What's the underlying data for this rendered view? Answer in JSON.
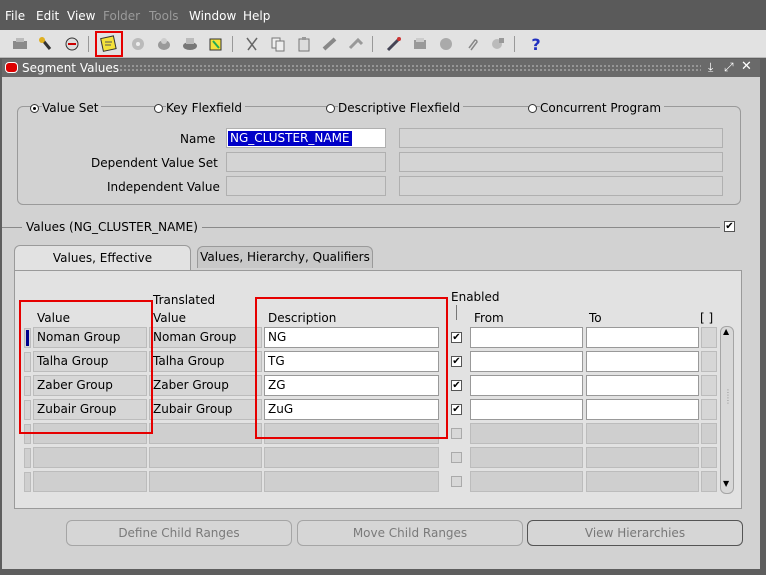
{
  "menu": [
    "File",
    "Edit",
    "View",
    "Folder",
    "Tools",
    "Window",
    "Help"
  ],
  "toolbar": {
    "icons": [
      "save-icon",
      "navigator-icon",
      "print-icon",
      "find-icon",
      "new-record-icon",
      "translation-icon",
      "zoom-icon",
      "export-icon",
      "cut-icon",
      "copy-icon",
      "paste-icon",
      "clear-icon",
      "delete-icon",
      "edit-icon",
      "attachments-icon",
      "folder-tools-icon",
      "help-icon"
    ],
    "help_glyph": "?"
  },
  "window": {
    "title": "Segment Values"
  },
  "options": [
    "Value Set",
    "Key Flexfield",
    "Descriptive Flexfield",
    "Concurrent Program"
  ],
  "selected_option": "Value Set",
  "form": {
    "name_label": "Name",
    "name_value": "NG_CLUSTER_NAME",
    "dependent_label": "Dependent Value Set",
    "independent_label": "Independent Value"
  },
  "values_section": {
    "title": "Values (NG_CLUSTER_NAME)"
  },
  "tabs": [
    "Values, Effective",
    "Values, Hierarchy, Qualifiers"
  ],
  "columns": {
    "value": "Value",
    "translated_line1": "Translated",
    "translated_line2": "Value",
    "description": "Description",
    "enabled": "Enabled",
    "from": "From",
    "to": "To",
    "extra": "[ ]"
  },
  "rows": [
    {
      "value": "Noman Group",
      "translated": "Noman Group",
      "description": "NG",
      "enabled": true
    },
    {
      "value": "Talha Group",
      "translated": "Talha Group",
      "description": "TG",
      "enabled": true
    },
    {
      "value": "Zaber Group",
      "translated": "Zaber Group",
      "description": "ZG",
      "enabled": true
    },
    {
      "value": "Zubair Group",
      "translated": "Zubair Group",
      "description": "ZuG",
      "enabled": true
    },
    {
      "value": "",
      "translated": "",
      "description": "",
      "enabled": false
    },
    {
      "value": "",
      "translated": "",
      "description": "",
      "enabled": false
    },
    {
      "value": "",
      "translated": "",
      "description": "",
      "enabled": false
    }
  ],
  "buttons": {
    "define": "Define Child Ranges",
    "move": "Move Child Ranges",
    "view": "View Hierarchies"
  },
  "colors": {
    "highlight": "#0000c8",
    "annotation_red": "#e60000"
  }
}
